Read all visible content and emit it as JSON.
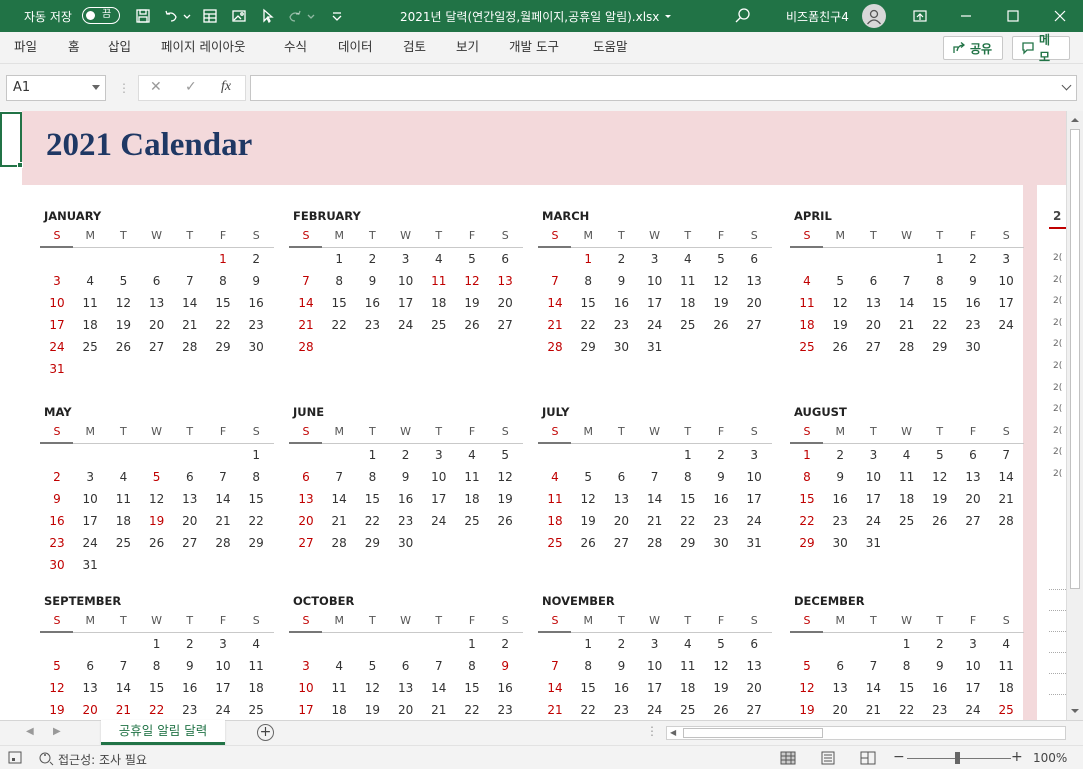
{
  "titlebar": {
    "autosave_label": "자동 저장",
    "autosave_state": "끔",
    "doc_title": "2021년 달력(연간일정,월페이지,공휴일 알림).xlsx",
    "user_name": "비즈폼친구4"
  },
  "ribbon": {
    "tabs": [
      "파일",
      "홈",
      "삽입",
      "페이지 레이아웃",
      "수식",
      "데이터",
      "검토",
      "보기",
      "개발 도구",
      "도움말"
    ],
    "share_label": "공유",
    "memo_label": "메모"
  },
  "formula_bar": {
    "name_box": "A1",
    "fx_label": "fx",
    "formula": ""
  },
  "calendar": {
    "title": "2021 Calendar",
    "dow": [
      "S",
      "M",
      "T",
      "W",
      "T",
      "F",
      "S"
    ],
    "months": [
      {
        "name": "JANUARY",
        "offset": 5,
        "days": 31,
        "holidays": [
          1
        ]
      },
      {
        "name": "FEBRUARY",
        "offset": 1,
        "days": 28,
        "holidays": [
          11,
          12,
          13
        ]
      },
      {
        "name": "MARCH",
        "offset": 1,
        "days": 31,
        "holidays": [
          1
        ]
      },
      {
        "name": "APRIL",
        "offset": 4,
        "days": 30,
        "holidays": []
      },
      {
        "name": "MAY",
        "offset": 6,
        "days": 31,
        "holidays": [
          5,
          19
        ]
      },
      {
        "name": "JUNE",
        "offset": 2,
        "days": 30,
        "holidays": []
      },
      {
        "name": "JULY",
        "offset": 4,
        "days": 31,
        "holidays": []
      },
      {
        "name": "AUGUST",
        "offset": 0,
        "days": 31,
        "holidays": [
          15
        ]
      },
      {
        "name": "SEPTEMBER",
        "offset": 3,
        "days": 30,
        "holidays": [
          20,
          21,
          22
        ]
      },
      {
        "name": "OCTOBER",
        "offset": 5,
        "days": 31,
        "holidays": [
          9
        ]
      },
      {
        "name": "NOVEMBER",
        "offset": 1,
        "days": 30,
        "holidays": []
      },
      {
        "name": "DECEMBER",
        "offset": 3,
        "days": 31,
        "holidays": [
          25
        ]
      }
    ],
    "side_year": "2",
    "side_rows": [
      "2(",
      "2(",
      "2(",
      "2(",
      "2(",
      "2(",
      "2(",
      "2(",
      "2(",
      "2(",
      "2("
    ]
  },
  "sheet_tabs": {
    "active": "공휴일 알림 달력"
  },
  "statusbar": {
    "accessibility": "접근성: 조사 필요",
    "zoom_minus": "−",
    "zoom_plus": "+",
    "zoom": "100%"
  },
  "colors": {
    "excel_green": "#217346",
    "sheet_pink": "#f3d9db",
    "title_navy": "#1f3864",
    "holiday_red": "#c00000"
  }
}
